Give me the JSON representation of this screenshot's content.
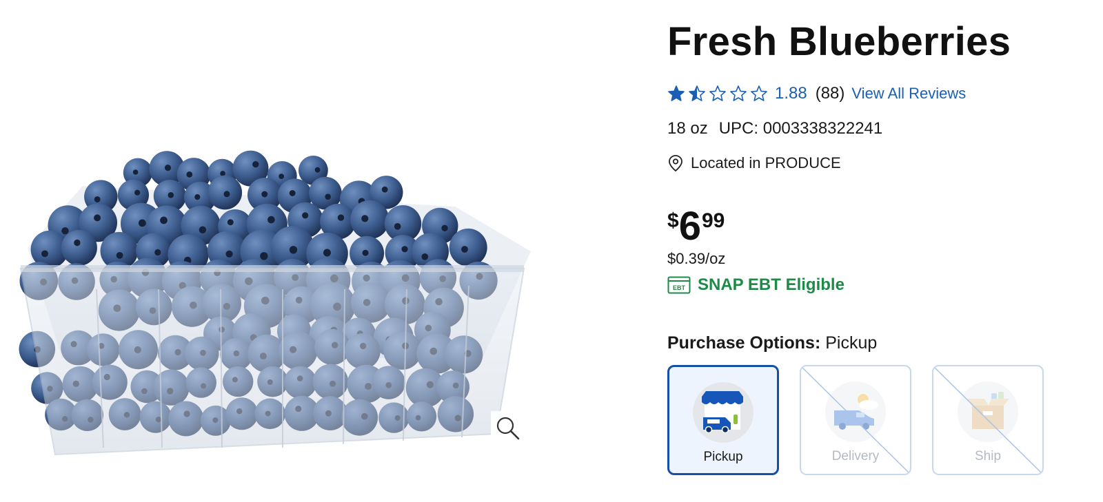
{
  "product": {
    "title": "Fresh Blueberries",
    "image_alt": "blueberries-in-clamshell-container"
  },
  "rating": {
    "value": "1.88",
    "stars_filled": 1.5,
    "stars_total": 5,
    "review_count": "(88)",
    "view_all_label": "View All Reviews"
  },
  "meta": {
    "size": "18 oz",
    "upc": "UPC: 0003338322241"
  },
  "location": {
    "icon": "map-pin-icon",
    "text": "Located in PRODUCE"
  },
  "price": {
    "currency": "$",
    "dollars": "6",
    "cents": "99",
    "unit_price": "$0.39/oz"
  },
  "snap": {
    "icon": "ebt-card-icon",
    "icon_text": "EBT",
    "label": "SNAP EBT Eligible",
    "color": "#1e8a47"
  },
  "purchase": {
    "heading_label": "Purchase Options:",
    "selected_value": "Pickup",
    "options": [
      {
        "label": "Pickup",
        "icon": "store-pickup-icon",
        "selected": true,
        "available": true
      },
      {
        "label": "Delivery",
        "icon": "delivery-van-icon",
        "selected": false,
        "available": false
      },
      {
        "label": "Ship",
        "icon": "shipping-box-icon",
        "selected": false,
        "available": false
      }
    ]
  },
  "colors": {
    "accent": "#1a5fb4",
    "selected_border": "#1550a8",
    "snap_green": "#1e8a47"
  },
  "zoom": {
    "icon": "magnifier-icon"
  }
}
